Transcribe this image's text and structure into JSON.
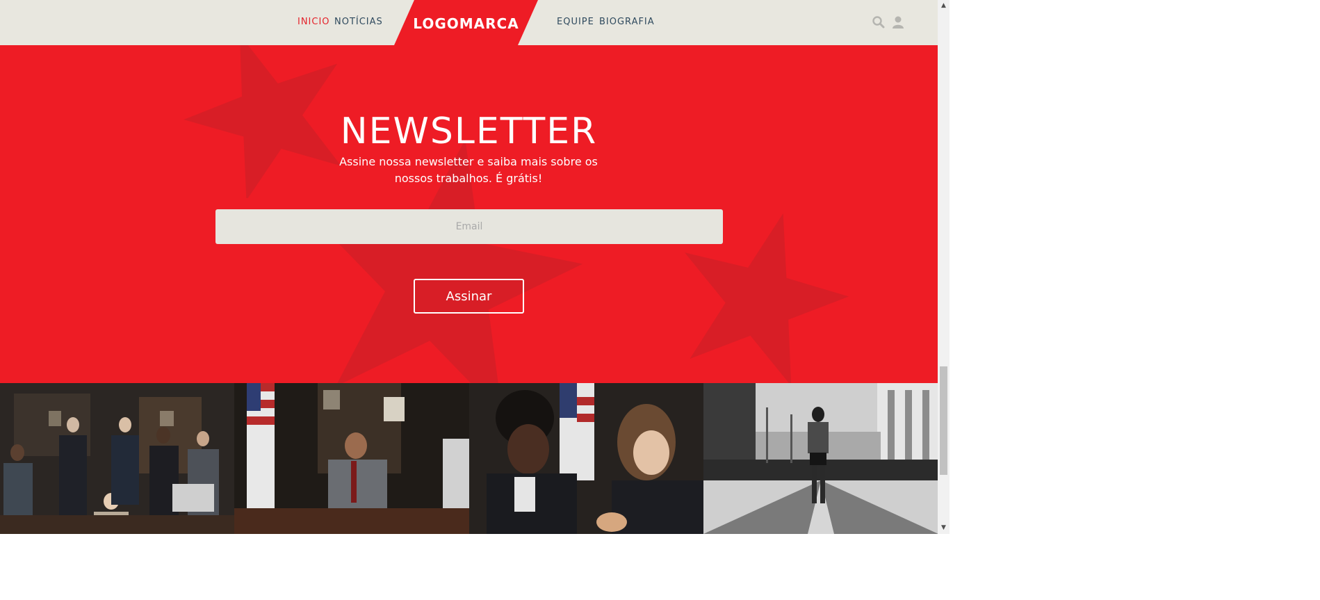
{
  "nav": {
    "left_links": [
      {
        "label": "INICIO",
        "active": true
      },
      {
        "label": "NOTÍCIAS",
        "active": false
      }
    ],
    "logo_text": "LOGOMARCA",
    "right_links": [
      {
        "label": "EQUIPE"
      },
      {
        "label": "BIOGRAFIA"
      }
    ],
    "icons": [
      "search-icon",
      "user-icon"
    ]
  },
  "newsletter": {
    "title": "NEWSLETTER",
    "subtitle": "Assine nossa newsletter e saiba mais sobre os nossos trabalhos. É grátis!",
    "email_placeholder": "Email",
    "email_value": "",
    "button_label": "Assinar"
  },
  "gallery": {
    "photos": [
      "team-group-photo",
      "man-at-desk-photo",
      "women-reviewing-documents-photo",
      "street-bw-photo"
    ]
  },
  "colors": {
    "brand_red": "#ee1c25",
    "header_bg": "#e8e7df",
    "nav_text": "#2f4a5e",
    "nav_active": "#e4232b",
    "input_bg": "#e6e5de"
  }
}
